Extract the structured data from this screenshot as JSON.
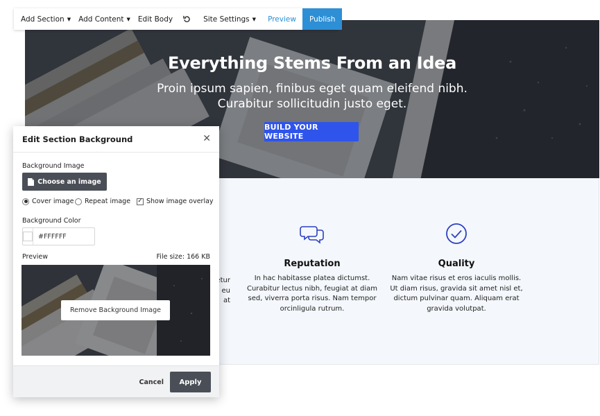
{
  "toolbar": {
    "add_section": "Add Section",
    "add_content": "Add Content",
    "edit_body": "Edit Body",
    "undo_icon": "undo-icon",
    "site_settings": "Site Settings",
    "preview": "Preview",
    "publish": "Publish"
  },
  "hero": {
    "title": "Everything Stems From an Idea",
    "subtitle": "Proin ipsum sapien, finibus eget quam eleifend nibh. Curabitur sollicitudin justo eget.",
    "cta": "BUILD YOUR WEBSITE"
  },
  "features": {
    "partial_text": "etur\ne eu\nat",
    "items": [
      {
        "icon": "chat-bubbles-icon",
        "title": "Reputation",
        "text": "In hac habitasse platea dictumst. Curabitur lectus nibh, feugiat at diam sed, viverra porta risus. Nam tempor orcinligula rutrum."
      },
      {
        "icon": "check-circle-icon",
        "title": "Quality",
        "text": "Nam vitae risus et eros iaculis mollis. Ut diam risus, gravida sit amet nisl et, dictum pulvinar quam. Aliquam erat gravida volutpat."
      }
    ]
  },
  "modal": {
    "title": "Edit Section Background",
    "background_image_label": "Background Image",
    "choose_image": "Choose an image",
    "options": {
      "cover": "Cover image",
      "repeat": "Repeat image",
      "overlay": "Show image overlay"
    },
    "cover_selected": true,
    "overlay_checked": true,
    "background_color_label": "Background Color",
    "background_color": "#FFFFFF",
    "preview_label": "Preview",
    "file_size": "File size: 166 KB",
    "remove_image": "Remove Background Image",
    "cancel": "Cancel",
    "apply": "Apply"
  },
  "colors": {
    "accent_blue": "#2d8fd5",
    "cta_blue": "#2f54eb",
    "icon_blue": "#2b3fc2",
    "dark_button": "#4a4f57"
  }
}
